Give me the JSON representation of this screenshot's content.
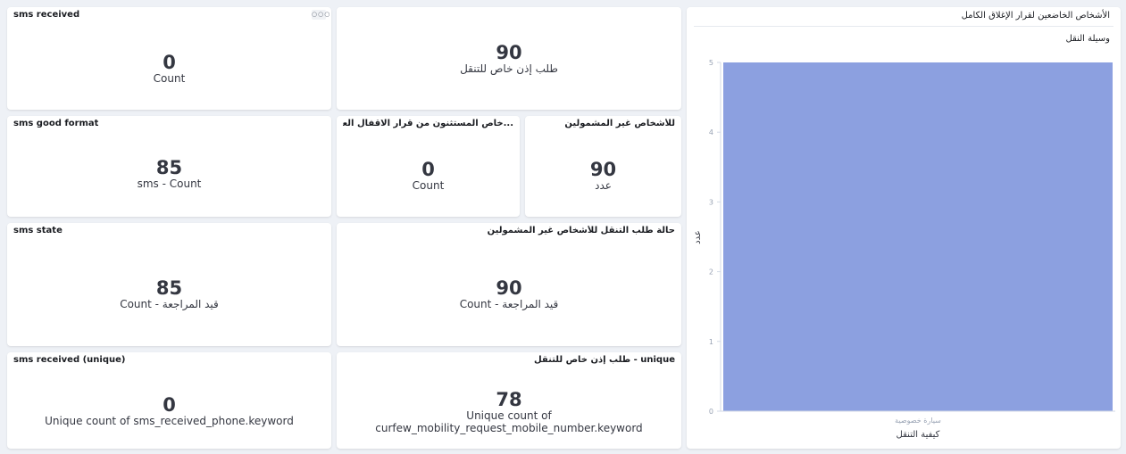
{
  "panels": {
    "sms_received": {
      "title": "sms received",
      "menu": "○○○",
      "value": "0",
      "label": "Count"
    },
    "mobility_request": {
      "value": "90",
      "label": "طلب إذن خاص للتنقل"
    },
    "sms_good_format": {
      "title": "sms good format",
      "value": "85",
      "label": "sms - Count"
    },
    "excluded_persons": {
      "title": "...خاص المستثنون من قرار الاقفال العام",
      "value": "0",
      "label": "Count"
    },
    "not_covered": {
      "title": "للأشخاص غير المشمولين",
      "value": "90",
      "label": "عدد"
    },
    "sms_state": {
      "title": "sms state",
      "value": "85",
      "label": "Count - قيد المراجعة"
    },
    "mobility_state": {
      "title": "حالة طلب التنقل للأشخاص غير المشمولين",
      "value": "90",
      "label": "Count - قيد المراجعة"
    },
    "sms_received_unique": {
      "title": "sms received (unique)",
      "value": "0",
      "label": "Unique count of sms_received_phone.keyword"
    },
    "mobility_unique": {
      "title": "unique - طلب إذن خاص للتنقل",
      "value": "78",
      "label_line1": "Unique count of",
      "label_line2": "curfew_mobility_request_mobile_number.keyword"
    }
  },
  "chart_panel": {
    "title": "الأشخاص الخاضعين لقرار الإغلاق الكامل",
    "legend_title": "وسيلة النقل"
  },
  "chart_data": {
    "type": "bar",
    "categories": [
      "سيارة خصوصية"
    ],
    "values": [
      5
    ],
    "xlabel": "كيفية التنقل",
    "ylabel": "عدد",
    "ylim": [
      0,
      5
    ],
    "yticks": [
      "0",
      "1",
      "2",
      "3",
      "4",
      "5"
    ],
    "bar_color": "#8ca0e0",
    "grid": false
  }
}
